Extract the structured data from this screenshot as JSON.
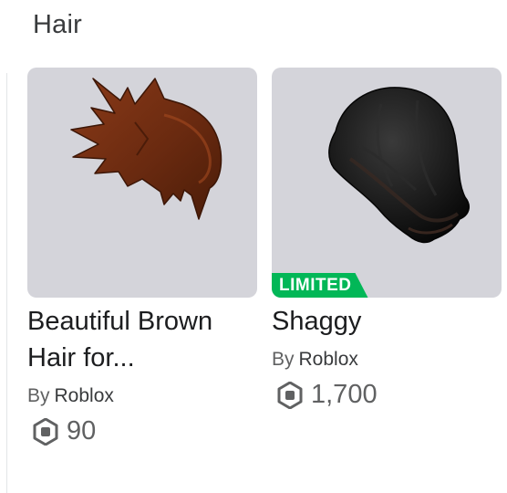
{
  "section": {
    "title": "Hair"
  },
  "items": [
    {
      "name": "Beautiful Brown Hair for...",
      "by_label": "By",
      "creator": "Roblox",
      "price": "90",
      "badge": "",
      "thumbnail_icon": "brown-spiky-hair-icon"
    },
    {
      "name": "Shaggy",
      "by_label": "By",
      "creator": "Roblox",
      "price": "1,700",
      "badge": "LIMITED",
      "thumbnail_icon": "black-shaggy-hair-icon"
    }
  ],
  "colors": {
    "thumb_background": "#d4d4da",
    "limited_badge": "#02b757",
    "currency_icon": "#606162"
  },
  "currency_icon": "robux-icon"
}
